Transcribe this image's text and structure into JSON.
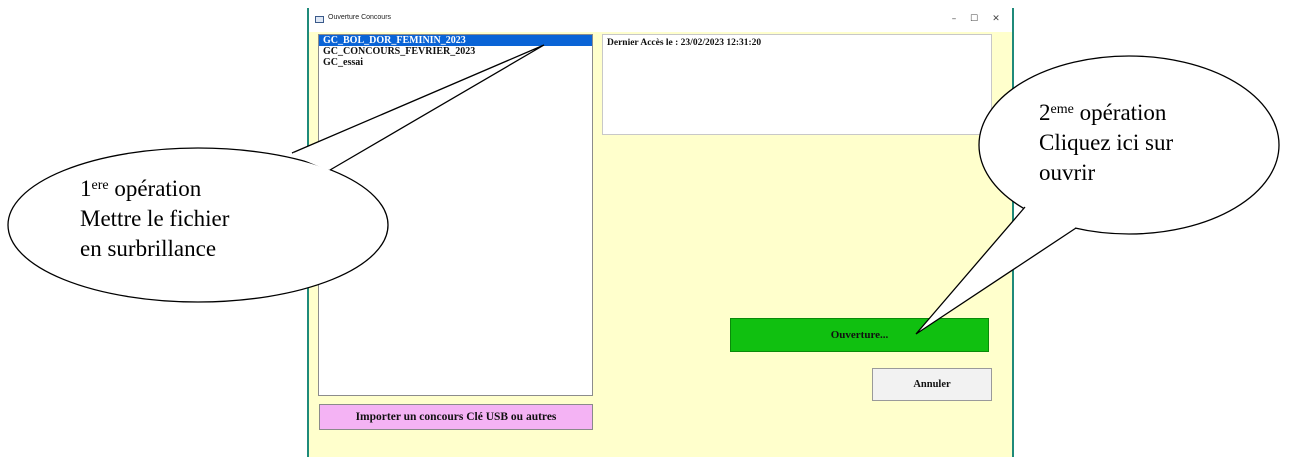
{
  "window": {
    "title": "Ouverture Concours",
    "controls": {
      "minimize": "–",
      "maximize": "☐",
      "close": "✕"
    }
  },
  "file_list": {
    "items": [
      {
        "label": "GC_BOL_DOR_FEMININ_2023",
        "selected": true
      },
      {
        "label": "GC_CONCOURS_FEVRIER_2023",
        "selected": false
      },
      {
        "label": "GC_essai",
        "selected": false
      }
    ]
  },
  "info_panel": {
    "last_access": "Dernier Accès le : 23/02/2023 12:31:20"
  },
  "buttons": {
    "open": "Ouverture...",
    "cancel": "Annuler",
    "import": "Importer un concours Clé USB ou autres"
  },
  "callouts": {
    "first": {
      "num": "1",
      "sup": "ere",
      "line1": " opération",
      "line2": "Mettre le fichier",
      "line3": "en surbrillance"
    },
    "second": {
      "num": "2",
      "sup": "eme",
      "line1": " opération",
      "line2": "Cliquez ici sur",
      "line3": "ouvrir"
    }
  },
  "colors": {
    "selection": "#0a64d6",
    "window_bg": "#ffffcc",
    "open_button": "#10c010",
    "import_button": "#f4b3f4",
    "frame_border": "#1f8a7a"
  }
}
